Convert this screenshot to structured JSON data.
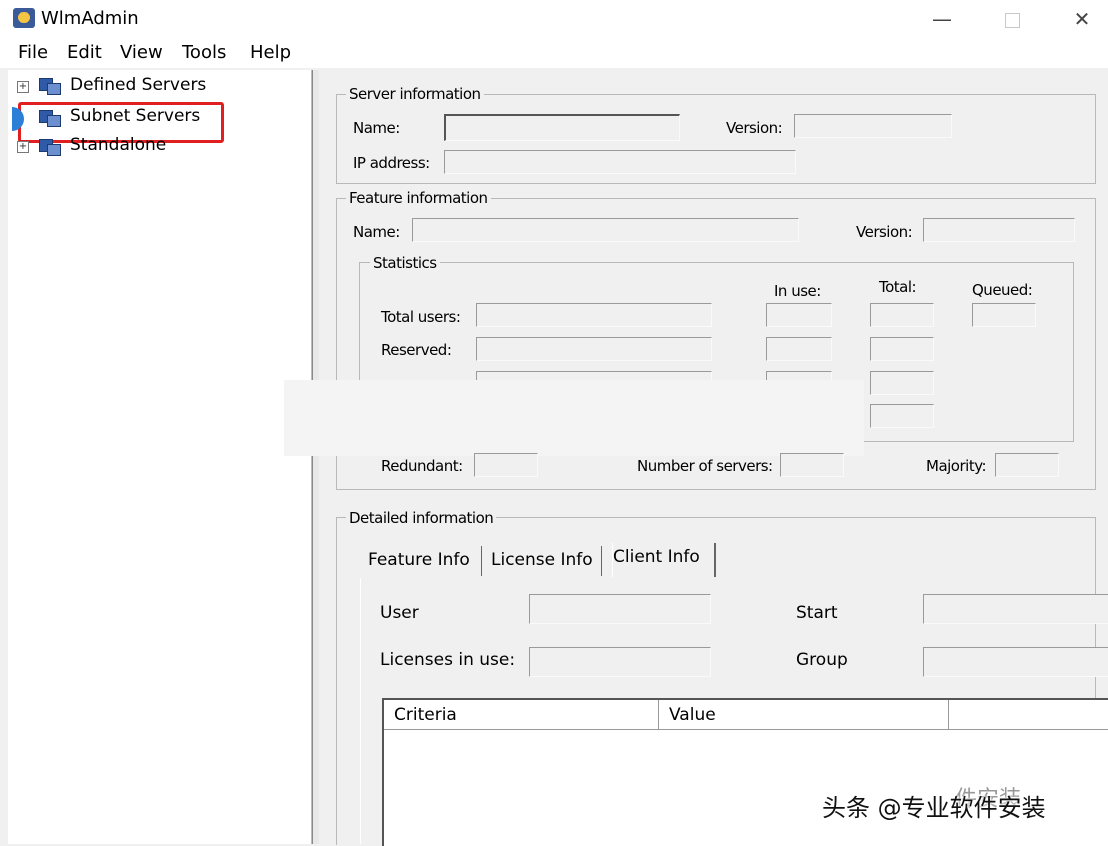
{
  "window": {
    "title": "WlmAdmin",
    "minimize": "—",
    "close": "✕"
  },
  "menu": [
    "File",
    "Edit",
    "View",
    "Tools",
    "Help"
  ],
  "tree": [
    {
      "label": "Defined Servers",
      "expander": "+"
    },
    {
      "label": "Subnet Servers",
      "expander": "+"
    },
    {
      "label": "Standalone",
      "expander": "+"
    }
  ],
  "server_info": {
    "title": "Server information",
    "name_label": "Name:",
    "version_label": "Version:",
    "ip_label": "IP address:",
    "name": "",
    "version": "",
    "ip": ""
  },
  "feature_info": {
    "title": "Feature information",
    "name_label": "Name:",
    "version_label": "Version:",
    "statistics": {
      "title": "Statistics",
      "col_in_use": "In use:",
      "col_total": "Total:",
      "col_queued": "Queued:",
      "row_total_users": "Total users:",
      "row_reserved": "Reserved:"
    },
    "redundant_label": "Redundant:",
    "num_servers_label": "Number of servers:",
    "majority_label": "Majority:"
  },
  "detailed_info": {
    "title": "Detailed information",
    "tabs": [
      "Feature Info",
      "License Info",
      "Client Info"
    ],
    "active_tab": "Client Info",
    "user_label": "User",
    "licenses_label": "Licenses in use:",
    "start_label": "Start",
    "group_label": "Group",
    "columns": [
      "Criteria",
      "Value"
    ]
  },
  "watermark": {
    "text": "头条 @专业软件安装",
    "faint": "件安装"
  }
}
